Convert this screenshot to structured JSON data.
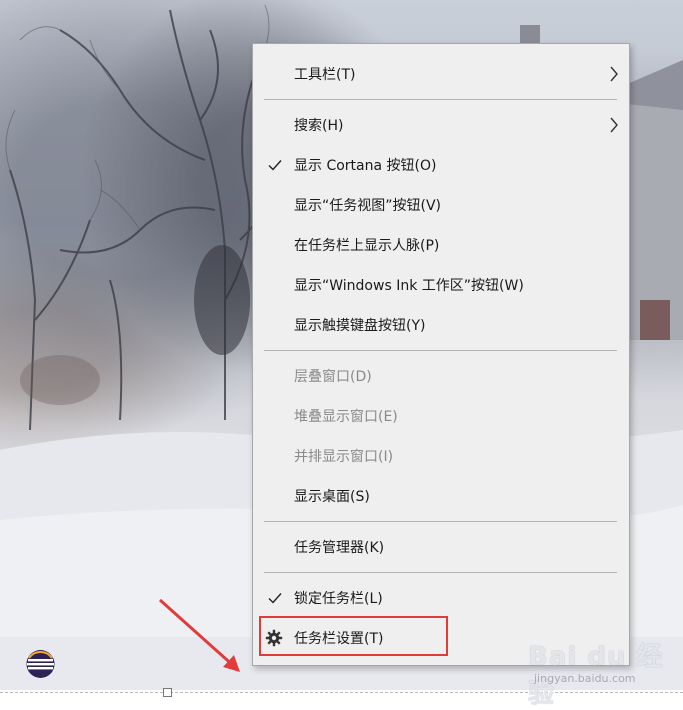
{
  "context_menu": {
    "items": [
      {
        "label": "工具栏(T)",
        "submenu": true,
        "checked": false,
        "disabled": false
      },
      {
        "label": "搜索(H)",
        "submenu": true,
        "checked": false,
        "disabled": false
      },
      {
        "label": "显示 Cortana 按钮(O)",
        "submenu": false,
        "checked": true,
        "disabled": false
      },
      {
        "label": "显示“任务视图”按钮(V)",
        "submenu": false,
        "checked": false,
        "disabled": false
      },
      {
        "label": "在任务栏上显示人脉(P)",
        "submenu": false,
        "checked": false,
        "disabled": false
      },
      {
        "label": "显示“Windows Ink 工作区”按钮(W)",
        "submenu": false,
        "checked": false,
        "disabled": false
      },
      {
        "label": "显示触摸键盘按钮(Y)",
        "submenu": false,
        "checked": false,
        "disabled": false
      },
      {
        "label": "层叠窗口(D)",
        "submenu": false,
        "checked": false,
        "disabled": true
      },
      {
        "label": "堆叠显示窗口(E)",
        "submenu": false,
        "checked": false,
        "disabled": true
      },
      {
        "label": "并排显示窗口(I)",
        "submenu": false,
        "checked": false,
        "disabled": true
      },
      {
        "label": "显示桌面(S)",
        "submenu": false,
        "checked": false,
        "disabled": false
      },
      {
        "label": "任务管理器(K)",
        "submenu": false,
        "checked": false,
        "disabled": false
      },
      {
        "label": "锁定任务栏(L)",
        "submenu": false,
        "checked": true,
        "disabled": false
      },
      {
        "label": "任务栏设置(T)",
        "submenu": false,
        "checked": false,
        "disabled": false,
        "icon": "gear-icon"
      }
    ]
  },
  "annotation": {
    "highlight_color": "#e23b3b",
    "arrow_color": "#e23b3b"
  },
  "taskbar": {
    "app_icon": "eclipse-icon"
  },
  "watermark": {
    "main": "Bai du 经验",
    "sub": "jingyan.baidu.com"
  }
}
